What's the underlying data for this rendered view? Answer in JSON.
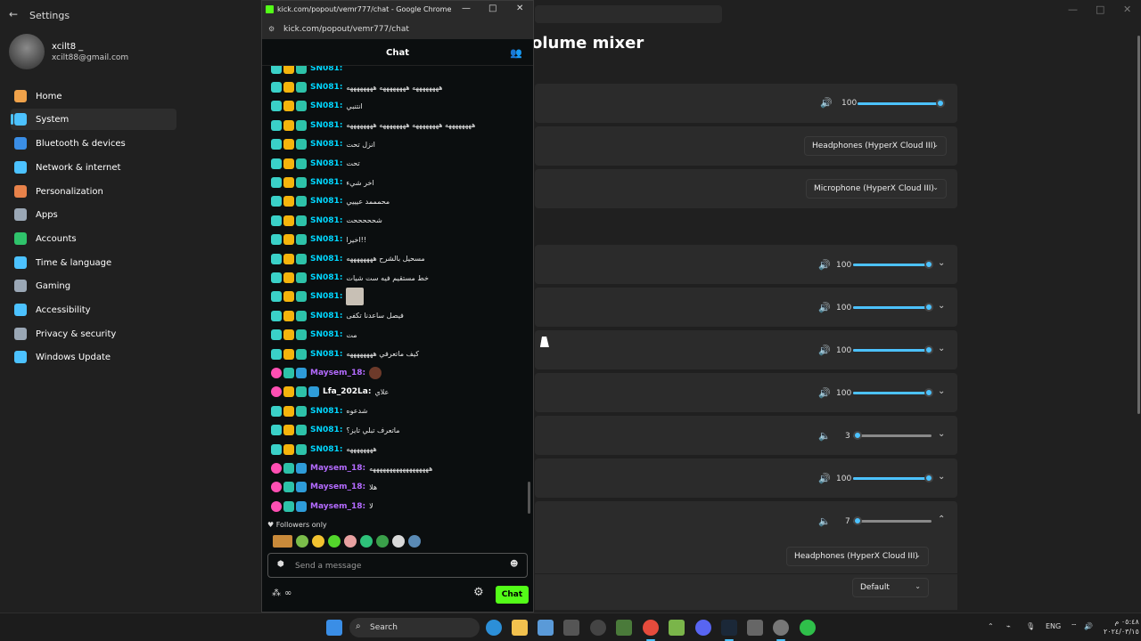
{
  "settings": {
    "title": "Settings",
    "user_name": "xcilt8 _",
    "user_email": "xcilt88@gmail.com",
    "nav": [
      {
        "label": "Home",
        "icon": "home-icon",
        "color": "#f0a24a"
      },
      {
        "label": "System",
        "icon": "system-icon",
        "color": "#4cc2ff"
      },
      {
        "label": "Bluetooth & devices",
        "icon": "bluetooth-icon",
        "color": "#3a8ee6"
      },
      {
        "label": "Network & internet",
        "icon": "wifi-icon",
        "color": "#4cc2ff"
      },
      {
        "label": "Personalization",
        "icon": "brush-icon",
        "color": "#e8824a"
      },
      {
        "label": "Apps",
        "icon": "apps-icon",
        "color": "#9aa7b5"
      },
      {
        "label": "Accounts",
        "icon": "accounts-icon",
        "color": "#2fc36b"
      },
      {
        "label": "Time & language",
        "icon": "globe-icon",
        "color": "#4cc2ff"
      },
      {
        "label": "Gaming",
        "icon": "gamepad-icon",
        "color": "#9aa7b5"
      },
      {
        "label": "Accessibility",
        "icon": "accessibility-icon",
        "color": "#4cc2ff"
      },
      {
        "label": "Privacy & security",
        "icon": "shield-icon",
        "color": "#9aa7b5"
      },
      {
        "label": "Windows Update",
        "icon": "update-icon",
        "color": "#4cc2ff"
      }
    ],
    "page_title": "olume mixer",
    "master_volume": "100",
    "output_device": "Headphones (HyperX Cloud III)",
    "input_device": "Microphone (HyperX Cloud III)",
    "apps": [
      {
        "volume": "100",
        "level": 1.0
      },
      {
        "volume": "100",
        "level": 1.0
      },
      {
        "volume": "100",
        "level": 1.0
      },
      {
        "volume": "100",
        "level": 1.0
      },
      {
        "volume": "3",
        "level": 0.03
      },
      {
        "volume": "100",
        "level": 1.0
      },
      {
        "volume": "7",
        "level": 0.07
      }
    ],
    "app_output_device": "Headphones (HyperX Cloud III)",
    "app_input_device": "Default"
  },
  "chrome": {
    "window_title": "kick.com/popout/vemr777/chat - Google Chrome",
    "url": "kick.com/popout/vemr777/chat",
    "chat_title": "Chat",
    "followers_only": "Followers only",
    "input_placeholder": "Send a message",
    "chat_button": "Chat"
  },
  "messages": [
    {
      "user": "SN081",
      "text": "ههههههههه ههههههههه ههههههههه",
      "type": "sn"
    },
    {
      "user": "SN081",
      "text": "انتنبي",
      "type": "sn"
    },
    {
      "user": "SN081",
      "text": "ههههههههه ههههههههه ههههههههه ههههههههه",
      "type": "sn"
    },
    {
      "user": "SN081",
      "text": "انزل تحت",
      "type": "sn"
    },
    {
      "user": "SN081",
      "text": "تحت",
      "type": "sn"
    },
    {
      "user": "SN081",
      "text": "اخر شيء",
      "type": "sn"
    },
    {
      "user": "SN081",
      "text": "محمممد عيييي",
      "type": "sn"
    },
    {
      "user": "SN081",
      "text": "شحححححت",
      "type": "sn"
    },
    {
      "user": "SN081",
      "text": "اخيرا!!",
      "type": "sn"
    },
    {
      "user": "SN081",
      "text": "مسحيل بالشرح ههههههههه",
      "type": "sn"
    },
    {
      "user": "SN081",
      "text": "خط مستقيم فيه ست شيات",
      "type": "sn"
    },
    {
      "user": "SN081",
      "text": "",
      "type": "sn-img"
    },
    {
      "user": "SN081",
      "text": "فيصل ساعدنا تكفى",
      "type": "sn"
    },
    {
      "user": "SN081",
      "text": "مت",
      "type": "sn"
    },
    {
      "user": "SN081",
      "text": "كيف ماتعرفي ههههههههه",
      "type": "sn"
    },
    {
      "user": "Maysem_18",
      "text": "",
      "type": "my-img"
    },
    {
      "user": "Lfa_202La",
      "text": "علاي",
      "type": "lf"
    },
    {
      "user": "SN081",
      "text": "شدعوه",
      "type": "sn"
    },
    {
      "user": "SN081",
      "text": "ماتعرف تبلي تايز؟",
      "type": "sn"
    },
    {
      "user": "SN081",
      "text": "ههههههههه",
      "type": "sn"
    },
    {
      "user": "Maysem_18",
      "text": "ههههههههههههههههههه",
      "type": "my"
    },
    {
      "user": "Maysem_18",
      "text": "هلا",
      "type": "my"
    },
    {
      "user": "Maysem_18",
      "text": "لا",
      "type": "my"
    }
  ],
  "taskbar": {
    "search_label": "Search",
    "lang": "ENG",
    "time": "٠٥:٤٨ م",
    "date": "٢٠٢٤/٠٣/١٥"
  }
}
